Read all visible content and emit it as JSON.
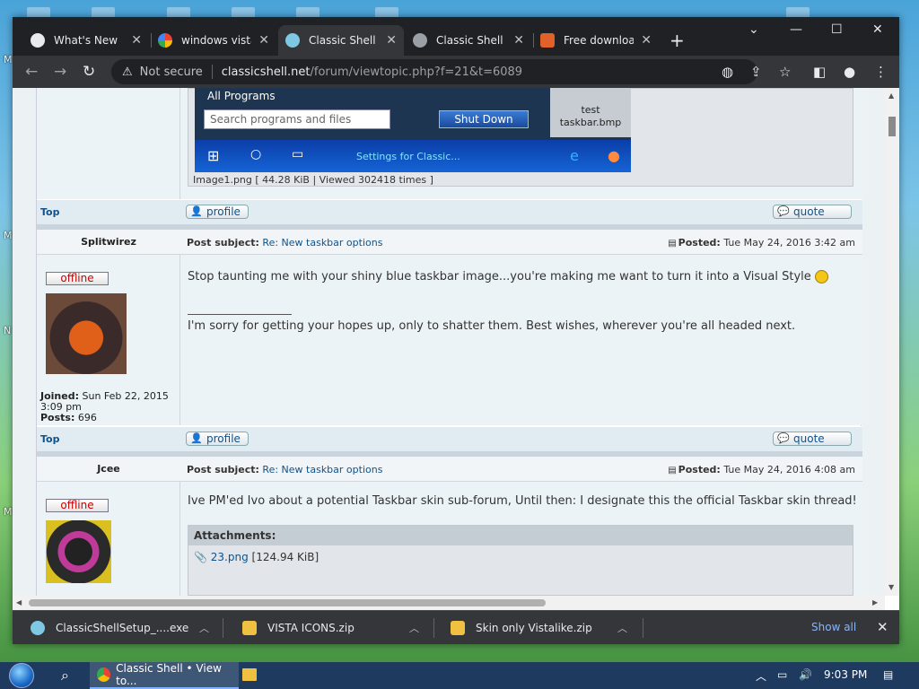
{
  "desktop": {
    "letters": [
      "M",
      "M",
      "N",
      "M"
    ]
  },
  "browser": {
    "tabs": [
      {
        "title": "What's New",
        "active": false
      },
      {
        "title": "windows vista",
        "active": false
      },
      {
        "title": "Classic Shell •",
        "active": true
      },
      {
        "title": "Classic Shell •",
        "active": false
      },
      {
        "title": "Free download",
        "active": false
      }
    ],
    "new_tab": "+",
    "window_controls": {
      "collapse": "⌄",
      "minimize": "—",
      "maximize": "☐",
      "close": "✕"
    },
    "toolbar": {
      "back": "←",
      "forward": "→",
      "reload": "↻",
      "not_secure": "Not secure",
      "url_host": "classicshell.net",
      "url_path": "/forum/viewtopic.php?f=21&t=6089"
    }
  },
  "page": {
    "startmenu": {
      "all_programs": "All Programs",
      "search_placeholder": "Search programs and files",
      "shut_down": "Shut Down",
      "test_tile": "test taskbar.bmp",
      "taskbar_item": "Settings for Classic..."
    },
    "image_caption": "Image1.png [ 44.28 KiB | Viewed 302418 times ]",
    "top_label": "Top",
    "profile_label": "profile",
    "quote_label": "quote",
    "posts": [
      {
        "author": "Splitwirez",
        "subject_label": "Post subject:",
        "subject": "Re: New taskbar options",
        "posted_label": "Posted:",
        "posted_date": "Tue May 24, 2016 3:42 am",
        "status": "offline",
        "joined_label": "Joined:",
        "joined": "Sun Feb 22, 2015 3:09 pm",
        "posts_label": "Posts:",
        "posts_count": "696",
        "body": "Stop taunting me with your shiny blue taskbar image...you're making me want to turn it into a Visual Style",
        "signature": "I'm sorry for getting your hopes up, only to shatter them. Best wishes, wherever you're all headed next."
      },
      {
        "author": "Jcee",
        "subject_label": "Post subject:",
        "subject": "Re: New taskbar options",
        "posted_label": "Posted:",
        "posted_date": "Tue May 24, 2016 4:08 am",
        "status": "offline",
        "body": "Ive PM'ed Ivo about a potential Taskbar skin sub-forum, Until then: I designate this the official Taskbar skin thread!",
        "attachments_label": "Attachments:",
        "attachment_name": "23.png",
        "attachment_size": "[124.94 KiB]"
      }
    ]
  },
  "downloads": {
    "items": [
      "ClassicShellSetup_....exe",
      "VISTA ICONS.zip",
      "Skin only Vistalike.zip"
    ],
    "show_all": "Show all",
    "close": "✕"
  },
  "taskbar": {
    "chrome_title": "Classic Shell • View to...",
    "time": "9:03 PM"
  },
  "colors": {
    "link": "#105289",
    "offline": "#cc0000",
    "accent": "#8ab4f8"
  }
}
